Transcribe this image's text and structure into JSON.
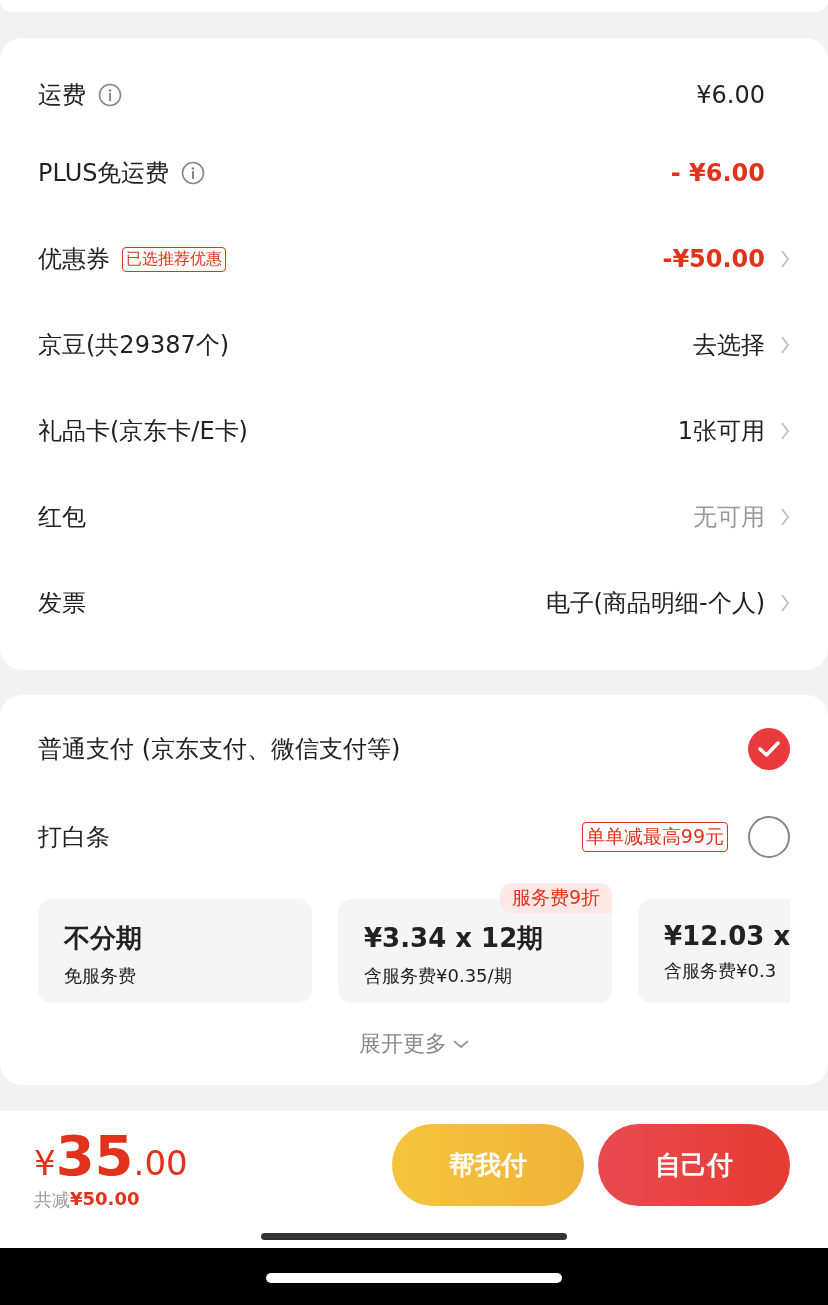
{
  "fees": [
    {
      "label": "运费",
      "info": true,
      "value": "¥6.00",
      "discount": false,
      "disabled": false,
      "chevron": false
    },
    {
      "label": "PLUS免运费",
      "info": true,
      "value": "- ¥6.00",
      "discount": true,
      "disabled": false,
      "chevron": false
    },
    {
      "label": "优惠券",
      "info": false,
      "tag": "已选推荐优惠",
      "value": "-¥50.00",
      "discount": true,
      "disabled": false,
      "chevron": true
    },
    {
      "label": "京豆(共29387个)",
      "info": false,
      "value": "去选择",
      "discount": false,
      "disabled": false,
      "chevron": true
    },
    {
      "label": "礼品卡(京东卡/E卡)",
      "info": false,
      "value": "1张可用",
      "discount": false,
      "disabled": false,
      "chevron": true
    },
    {
      "label": "红包",
      "info": false,
      "value": "无可用",
      "discount": false,
      "disabled": true,
      "chevron": true
    },
    {
      "label": "发票",
      "info": false,
      "value": "电子(商品明细-个人)",
      "discount": false,
      "disabled": false,
      "chevron": true
    }
  ],
  "payment_methods": [
    {
      "label": "普通支付 (京东支付、微信支付等)",
      "selected": true
    },
    {
      "label": "打白条",
      "tag": "单单减最高99元",
      "selected": false
    }
  ],
  "installments": [
    {
      "title": "不分期",
      "note": "免服务费"
    },
    {
      "title": "¥3.34 x 12期",
      "note": "含服务费¥0.35/期",
      "badge": "服务费9折"
    },
    {
      "title": "¥12.03 x",
      "note": "含服务费¥0.3"
    }
  ],
  "expand_more": "展开更多",
  "footer": {
    "currency": "¥",
    "amount": "35",
    "decimals": ".00",
    "saving_label": "共减",
    "saving": "¥50.00",
    "buttons": [
      {
        "label": "帮我付",
        "kind": "friend"
      },
      {
        "label": "自己付",
        "kind": "self"
      }
    ]
  }
}
